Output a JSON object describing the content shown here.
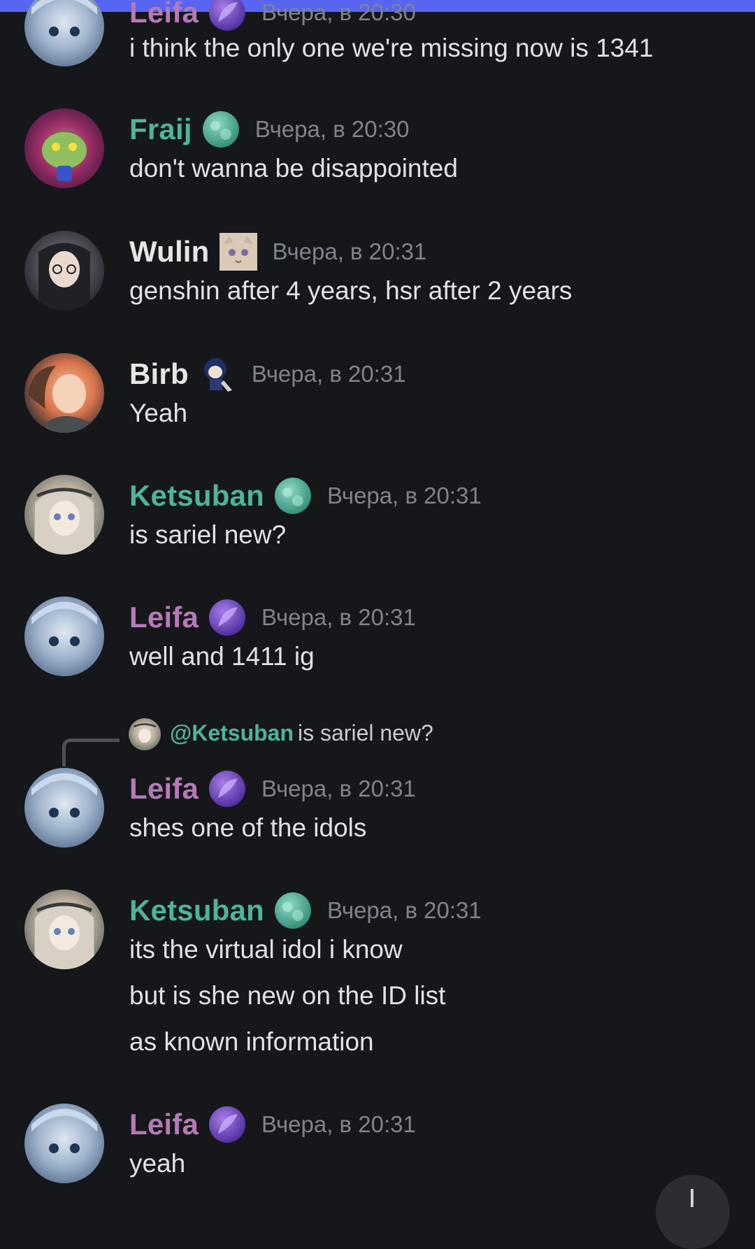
{
  "colors": {
    "background": "#16171b",
    "accent_bar": "#5865f2",
    "leifa_name": "#b57ab5",
    "teal_name": "#4fb39a",
    "white_name": "#e6e6e6",
    "timestamp": "#7f848c"
  },
  "messages": [
    {
      "id": "m0",
      "username": "Leifa",
      "timestamp": "Вчера, в 20:30",
      "badge_icon": "purple-feather-icon",
      "lines": [
        "i think the only one we're missing now is 1341"
      ]
    },
    {
      "id": "m1",
      "username": "Fraij",
      "timestamp": "Вчера, в 20:30",
      "badge_icon": "teal-orb-icon",
      "lines": [
        "don't wanna be disappointed"
      ]
    },
    {
      "id": "m2",
      "username": "Wulin",
      "timestamp": "Вчера, в 20:31",
      "badge_icon": "cat-face-icon",
      "lines": [
        "genshin after 4 years, hsr after 2 years"
      ]
    },
    {
      "id": "m3",
      "username": "Birb",
      "timestamp": "Вчера, в 20:31",
      "badge_icon": "chibi-character-icon",
      "lines": [
        "Yeah"
      ]
    },
    {
      "id": "m4",
      "username": "Ketsuban",
      "timestamp": "Вчера, в 20:31",
      "badge_icon": "teal-orb-icon",
      "lines": [
        "is sariel new?"
      ]
    },
    {
      "id": "m5",
      "username": "Leifa",
      "timestamp": "Вчера, в 20:31",
      "badge_icon": "purple-feather-icon",
      "lines": [
        "well and 1411 ig"
      ]
    },
    {
      "id": "m6",
      "username": "Leifa",
      "timestamp": "Вчера, в 20:31",
      "badge_icon": "purple-feather-icon",
      "reply_to": {
        "user": "@Ketsuban",
        "text": "is sariel new?"
      },
      "lines": [
        "shes one of the idols"
      ]
    },
    {
      "id": "m7",
      "username": "Ketsuban",
      "timestamp": "Вчера, в 20:31",
      "badge_icon": "teal-orb-icon",
      "lines": [
        "its the virtual idol i know",
        "but is she new on the ID list",
        "as known information"
      ]
    },
    {
      "id": "m8",
      "username": "Leifa",
      "timestamp": "Вчера, в 20:31",
      "badge_icon": "purple-feather-icon",
      "lines": [
        "yeah"
      ]
    }
  ],
  "scroll_button": {
    "icon": "arrow-down-icon"
  }
}
